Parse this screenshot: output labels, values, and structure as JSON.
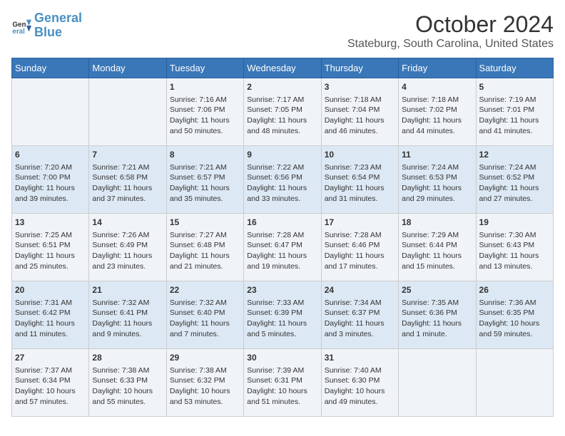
{
  "logo": {
    "line1": "General",
    "line2": "Blue"
  },
  "title": "October 2024",
  "subtitle": "Stateburg, South Carolina, United States",
  "days_of_week": [
    "Sunday",
    "Monday",
    "Tuesday",
    "Wednesday",
    "Thursday",
    "Friday",
    "Saturday"
  ],
  "weeks": [
    [
      {
        "day": "",
        "info": ""
      },
      {
        "day": "",
        "info": ""
      },
      {
        "day": "1",
        "info": "Sunrise: 7:16 AM\nSunset: 7:06 PM\nDaylight: 11 hours and 50 minutes."
      },
      {
        "day": "2",
        "info": "Sunrise: 7:17 AM\nSunset: 7:05 PM\nDaylight: 11 hours and 48 minutes."
      },
      {
        "day": "3",
        "info": "Sunrise: 7:18 AM\nSunset: 7:04 PM\nDaylight: 11 hours and 46 minutes."
      },
      {
        "day": "4",
        "info": "Sunrise: 7:18 AM\nSunset: 7:02 PM\nDaylight: 11 hours and 44 minutes."
      },
      {
        "day": "5",
        "info": "Sunrise: 7:19 AM\nSunset: 7:01 PM\nDaylight: 11 hours and 41 minutes."
      }
    ],
    [
      {
        "day": "6",
        "info": "Sunrise: 7:20 AM\nSunset: 7:00 PM\nDaylight: 11 hours and 39 minutes."
      },
      {
        "day": "7",
        "info": "Sunrise: 7:21 AM\nSunset: 6:58 PM\nDaylight: 11 hours and 37 minutes."
      },
      {
        "day": "8",
        "info": "Sunrise: 7:21 AM\nSunset: 6:57 PM\nDaylight: 11 hours and 35 minutes."
      },
      {
        "day": "9",
        "info": "Sunrise: 7:22 AM\nSunset: 6:56 PM\nDaylight: 11 hours and 33 minutes."
      },
      {
        "day": "10",
        "info": "Sunrise: 7:23 AM\nSunset: 6:54 PM\nDaylight: 11 hours and 31 minutes."
      },
      {
        "day": "11",
        "info": "Sunrise: 7:24 AM\nSunset: 6:53 PM\nDaylight: 11 hours and 29 minutes."
      },
      {
        "day": "12",
        "info": "Sunrise: 7:24 AM\nSunset: 6:52 PM\nDaylight: 11 hours and 27 minutes."
      }
    ],
    [
      {
        "day": "13",
        "info": "Sunrise: 7:25 AM\nSunset: 6:51 PM\nDaylight: 11 hours and 25 minutes."
      },
      {
        "day": "14",
        "info": "Sunrise: 7:26 AM\nSunset: 6:49 PM\nDaylight: 11 hours and 23 minutes."
      },
      {
        "day": "15",
        "info": "Sunrise: 7:27 AM\nSunset: 6:48 PM\nDaylight: 11 hours and 21 minutes."
      },
      {
        "day": "16",
        "info": "Sunrise: 7:28 AM\nSunset: 6:47 PM\nDaylight: 11 hours and 19 minutes."
      },
      {
        "day": "17",
        "info": "Sunrise: 7:28 AM\nSunset: 6:46 PM\nDaylight: 11 hours and 17 minutes."
      },
      {
        "day": "18",
        "info": "Sunrise: 7:29 AM\nSunset: 6:44 PM\nDaylight: 11 hours and 15 minutes."
      },
      {
        "day": "19",
        "info": "Sunrise: 7:30 AM\nSunset: 6:43 PM\nDaylight: 11 hours and 13 minutes."
      }
    ],
    [
      {
        "day": "20",
        "info": "Sunrise: 7:31 AM\nSunset: 6:42 PM\nDaylight: 11 hours and 11 minutes."
      },
      {
        "day": "21",
        "info": "Sunrise: 7:32 AM\nSunset: 6:41 PM\nDaylight: 11 hours and 9 minutes."
      },
      {
        "day": "22",
        "info": "Sunrise: 7:32 AM\nSunset: 6:40 PM\nDaylight: 11 hours and 7 minutes."
      },
      {
        "day": "23",
        "info": "Sunrise: 7:33 AM\nSunset: 6:39 PM\nDaylight: 11 hours and 5 minutes."
      },
      {
        "day": "24",
        "info": "Sunrise: 7:34 AM\nSunset: 6:37 PM\nDaylight: 11 hours and 3 minutes."
      },
      {
        "day": "25",
        "info": "Sunrise: 7:35 AM\nSunset: 6:36 PM\nDaylight: 11 hours and 1 minute."
      },
      {
        "day": "26",
        "info": "Sunrise: 7:36 AM\nSunset: 6:35 PM\nDaylight: 10 hours and 59 minutes."
      }
    ],
    [
      {
        "day": "27",
        "info": "Sunrise: 7:37 AM\nSunset: 6:34 PM\nDaylight: 10 hours and 57 minutes."
      },
      {
        "day": "28",
        "info": "Sunrise: 7:38 AM\nSunset: 6:33 PM\nDaylight: 10 hours and 55 minutes."
      },
      {
        "day": "29",
        "info": "Sunrise: 7:38 AM\nSunset: 6:32 PM\nDaylight: 10 hours and 53 minutes."
      },
      {
        "day": "30",
        "info": "Sunrise: 7:39 AM\nSunset: 6:31 PM\nDaylight: 10 hours and 51 minutes."
      },
      {
        "day": "31",
        "info": "Sunrise: 7:40 AM\nSunset: 6:30 PM\nDaylight: 10 hours and 49 minutes."
      },
      {
        "day": "",
        "info": ""
      },
      {
        "day": "",
        "info": ""
      }
    ]
  ]
}
